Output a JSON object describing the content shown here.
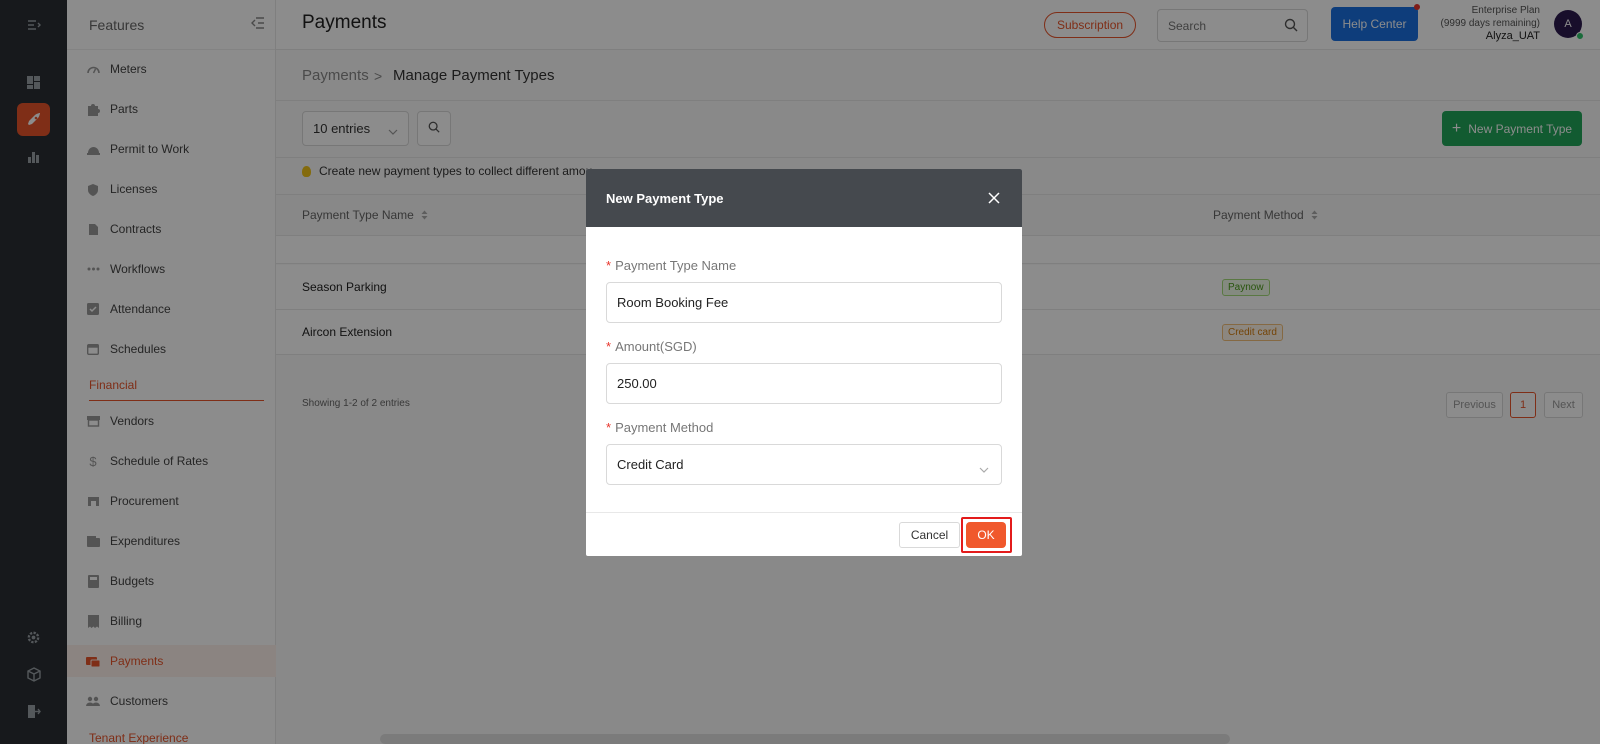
{
  "rail": {
    "icons": [
      "menu-icon",
      "dashboard-icon",
      "rocket-icon",
      "chart-icon",
      "settings-icon",
      "cube-icon",
      "logout-icon"
    ]
  },
  "sidebar": {
    "title": "Features",
    "items": [
      {
        "label": "Meters",
        "icon": "gauge-icon"
      },
      {
        "label": "Parts",
        "icon": "puzzle-icon"
      },
      {
        "label": "Permit to Work",
        "icon": "helmet-icon"
      },
      {
        "label": "Licenses",
        "icon": "shield-icon"
      },
      {
        "label": "Contracts",
        "icon": "document-icon"
      },
      {
        "label": "Workflows",
        "icon": "dots-icon"
      },
      {
        "label": "Attendance",
        "icon": "checkbox-icon"
      },
      {
        "label": "Schedules",
        "icon": "calendar-icon"
      }
    ],
    "group_financial": "Financial",
    "financial_items": [
      {
        "label": "Vendors",
        "icon": "store-icon"
      },
      {
        "label": "Schedule of Rates",
        "icon": "dollar-icon"
      },
      {
        "label": "Procurement",
        "icon": "cart-icon"
      },
      {
        "label": "Expenditures",
        "icon": "wallet-icon"
      },
      {
        "label": "Budgets",
        "icon": "calculator-icon"
      },
      {
        "label": "Billing",
        "icon": "receipt-icon"
      },
      {
        "label": "Payments",
        "icon": "payment-icon"
      },
      {
        "label": "Customers",
        "icon": "people-icon"
      }
    ],
    "group_tenant": "Tenant Experience"
  },
  "header": {
    "title": "Payments",
    "subscription_label": "Subscription",
    "search_placeholder": "Search",
    "help_label": "Help Center",
    "plan_line1": "Enterprise Plan",
    "plan_line2": "(9999 days remaining)",
    "username": "Alyza_UAT",
    "avatar_letter": "A"
  },
  "breadcrumb": {
    "parent": "Payments",
    "separator": ">",
    "current": "Manage Payment Types"
  },
  "toolbar": {
    "entries_label": "10 entries",
    "new_button_label": "New Payment Type"
  },
  "hint": "Create new payment types to collect different amou",
  "table": {
    "columns": [
      "Payment Type Name",
      "Payment Method"
    ],
    "rows": [
      {
        "name": "Season Parking",
        "method": "Paynow",
        "method_color": "#4b9b1b"
      },
      {
        "name": "Aircon Extension",
        "method": "Credit card",
        "method_color": "#d47c0c"
      }
    ],
    "showing": "Showing 1-2 of 2 entries",
    "pager": {
      "previous": "Previous",
      "current": "1",
      "next": "Next"
    }
  },
  "modal": {
    "title": "New Payment Type",
    "fields": {
      "name_label": "Payment Type Name",
      "name_value": "Room Booking Fee",
      "amount_label": "Amount(SGD)",
      "amount_value": "250.00",
      "method_label": "Payment Method",
      "method_value": "Credit Card",
      "required_mark": "*"
    },
    "cancel_label": "Cancel",
    "ok_label": "OK"
  },
  "colors": {
    "accent": "#e8542a",
    "primary_blue": "#1a6fe0",
    "success_green": "#22a65a",
    "rail_bg": "#2b2f33",
    "modal_header": "#45494e"
  }
}
